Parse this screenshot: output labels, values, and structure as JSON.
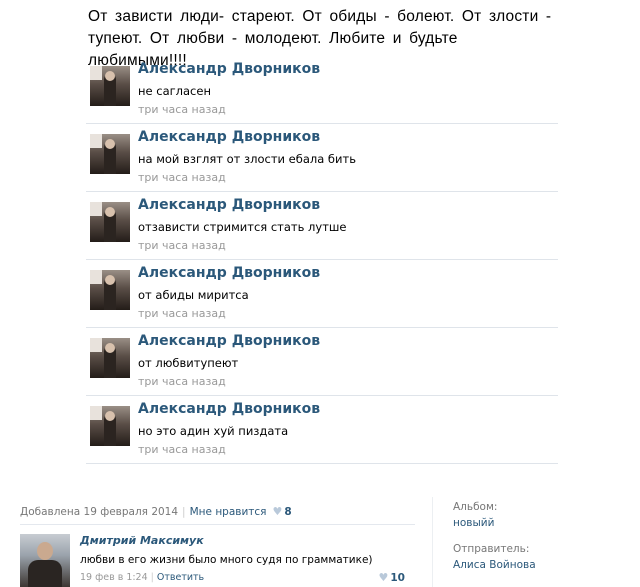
{
  "status_text": "От  зависти люди- стареют. От  обиды  - болеют. От  злости - тупеют.  От  любви - молодеют.  Любите и будьте  любимыми!!!!",
  "comments": [
    {
      "author": "Александр Дворников",
      "text": "не сагласен",
      "time": "три часа назад"
    },
    {
      "author": "Александр Дворников",
      "text": "на мой взглят от злости ебала бить",
      "time": "три часа назад"
    },
    {
      "author": "Александр Дворников",
      "text": "отзависти стримится стать лутше",
      "time": "три часа назад"
    },
    {
      "author": "Александр Дворников",
      "text": "от абиды миритса",
      "time": "три часа назад"
    },
    {
      "author": "Александр Дворников",
      "text": "от любвитупеют",
      "time": "три часа назад"
    },
    {
      "author": "Александр Дворников",
      "text": "но это адин хуй пиздата",
      "time": "три часа назад"
    }
  ],
  "photo_footer": {
    "added": "Добавлена 19 февраля 2014",
    "like_label": "Мне нравится",
    "like_count": "8"
  },
  "photo_comment": {
    "author": "Дмитрий Максимук",
    "text": "любви в его жизни было много судя по грамматике)",
    "time": "19 фев в 1:24",
    "reply_label": "Ответить",
    "like_count": "10"
  },
  "sidebar": {
    "album_label": "Альбом:",
    "album_value": "новыйй",
    "sender_label": "Отправитель:",
    "sender_value": "Алиса Войнова"
  },
  "colors": {
    "link": "#2b587a",
    "muted": "#999999",
    "heart": "#b9c9da"
  }
}
